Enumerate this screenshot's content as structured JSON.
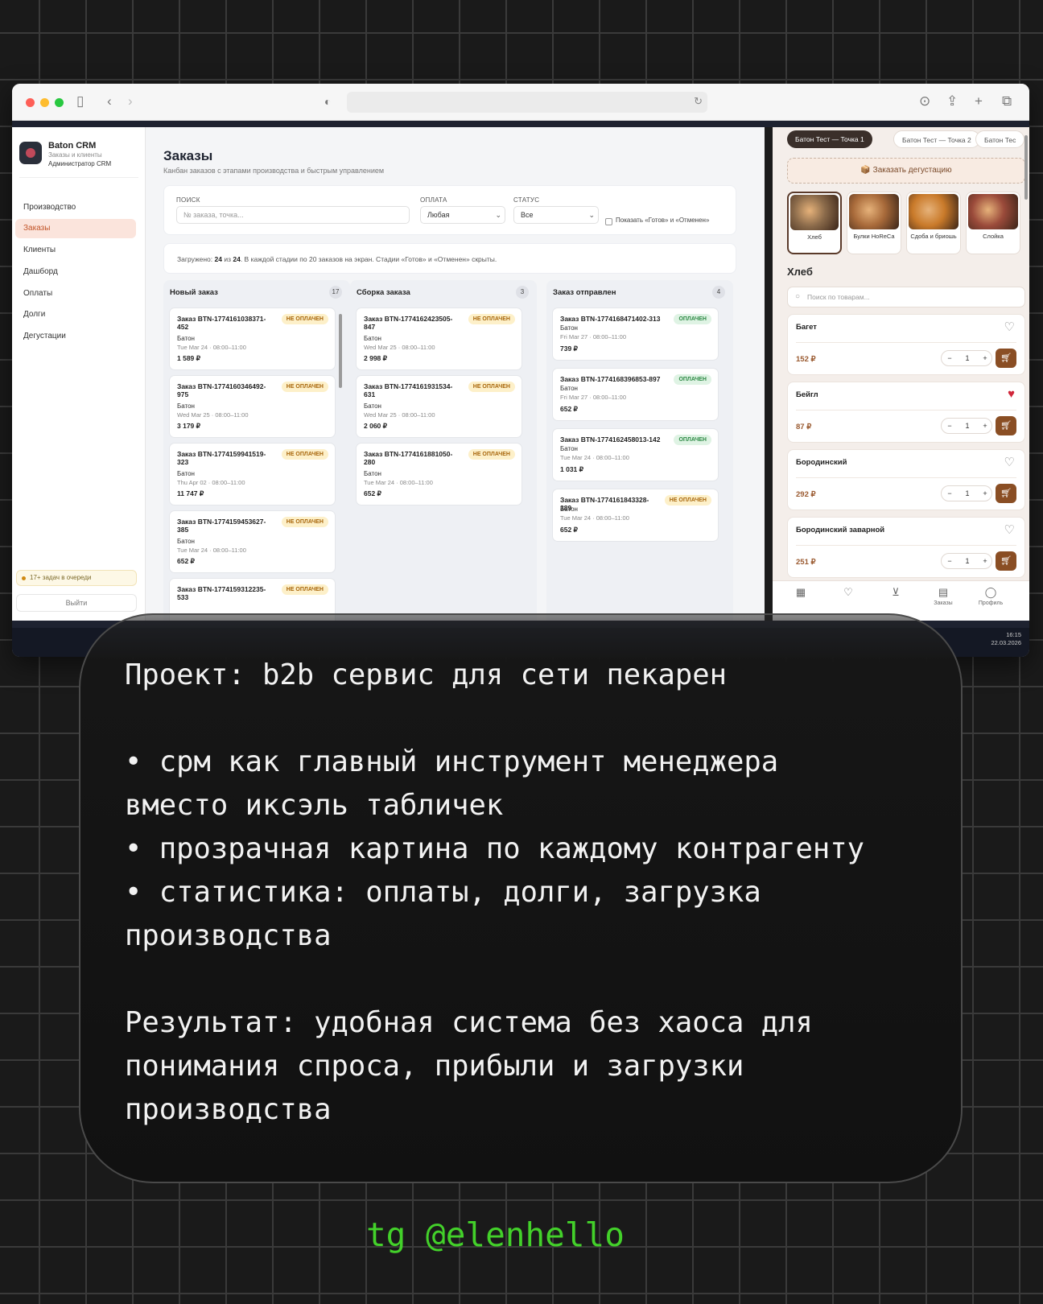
{
  "crm": {
    "brand": {
      "name": "Baton CRM",
      "subtitle": "Заказы и клиенты",
      "role": "Администратор CRM"
    },
    "nav": [
      "Производство",
      "Заказы",
      "Клиенты",
      "Дашборд",
      "Оплаты",
      "Долги",
      "Дегустации"
    ],
    "active_nav": "Заказы",
    "queue_note": "17+ задач в очереди",
    "logout": "Выйти",
    "page": {
      "title": "Заказы",
      "subtitle": "Канбан заказов с этапами производства и быстрым управлением"
    },
    "filters": {
      "search_label": "ПОИСК",
      "search_placeholder": "№ заказа, точка...",
      "payment_label": "ОПЛАТА",
      "payment_value": "Любая",
      "status_label": "СТАТУС",
      "status_value": "Все",
      "show_done_label": "Показать «Готов» и «Отменен»"
    },
    "loaded": {
      "prefix": "Загружено: ",
      "loaded": "24",
      "of": " из ",
      "total": "24",
      "suffix": ". В каждой стадии по 20 заказов на экран. Стадии «Готов» и «Отменен» скрыты."
    },
    "columns": [
      {
        "title": "Новый заказ",
        "count": "17",
        "cards": [
          {
            "id": "Заказ BTN-1774161038371-452",
            "badge": "НЕ ОПЛАЧЕН",
            "paid": false,
            "product": "Батон",
            "date": "Tue Mar 24 · 08:00–11:00",
            "sum": "1 589 ₽"
          },
          {
            "id": "Заказ BTN-1774160346492-975",
            "badge": "НЕ ОПЛАЧЕН",
            "paid": false,
            "product": "Батон",
            "date": "Wed Mar 25 · 08:00–11:00",
            "sum": "3 179 ₽"
          },
          {
            "id": "Заказ BTN-1774159941519-323",
            "badge": "НЕ ОПЛАЧЕН",
            "paid": false,
            "product": "Батон",
            "date": "Thu Apr 02 · 08:00–11:00",
            "sum": "11 747 ₽"
          },
          {
            "id": "Заказ BTN-1774159453627-385",
            "badge": "НЕ ОПЛАЧЕН",
            "paid": false,
            "product": "Батон",
            "date": "Tue Mar 24 · 08:00–11:00",
            "sum": "652 ₽"
          },
          {
            "id": "Заказ BTN-1774159312235-533",
            "badge": "НЕ ОПЛАЧЕН",
            "paid": false,
            "product": "",
            "date": "",
            "sum": ""
          }
        ]
      },
      {
        "title": "Сборка заказа",
        "count": "3",
        "cards": [
          {
            "id": "Заказ BTN-1774162423505-847",
            "badge": "НЕ ОПЛАЧЕН",
            "paid": false,
            "product": "Батон",
            "date": "Wed Mar 25 · 08:00–11:00",
            "sum": "2 998 ₽"
          },
          {
            "id": "Заказ BTN-1774161931534-631",
            "badge": "НЕ ОПЛАЧЕН",
            "paid": false,
            "product": "Батон",
            "date": "Wed Mar 25 · 08:00–11:00",
            "sum": "2 060 ₽"
          },
          {
            "id": "Заказ BTN-1774161881050-280",
            "badge": "НЕ ОПЛАЧЕН",
            "paid": false,
            "product": "Батон",
            "date": "Tue Mar 24 · 08:00–11:00",
            "sum": "652 ₽"
          }
        ]
      },
      {
        "title": "Заказ отправлен",
        "count": "4",
        "cards": [
          {
            "id": "Заказ BTN-1774168471402-313",
            "badge": "ОПЛАЧЕН",
            "paid": true,
            "product": "Батон",
            "date": "Fri Mar 27 · 08:00–11:00",
            "sum": "739 ₽"
          },
          {
            "id": "Заказ BTN-1774168396853-897",
            "badge": "ОПЛАЧЕН",
            "paid": true,
            "product": "Батон",
            "date": "Fri Mar 27 · 08:00–11:00",
            "sum": "652 ₽"
          },
          {
            "id": "Заказ BTN-1774162458013-142",
            "badge": "ОПЛАЧЕН",
            "paid": true,
            "product": "Батон",
            "date": "Tue Mar 24 · 08:00–11:00",
            "sum": "1 031 ₽"
          },
          {
            "id": "Заказ BTN-1774161843328-389",
            "badge": "НЕ ОПЛАЧЕН",
            "paid": false,
            "product": "Батон",
            "date": "Tue Mar 24 · 08:00–11:00",
            "sum": "652 ₽"
          }
        ]
      }
    ]
  },
  "shop": {
    "tabs": [
      "Батон Тест — Точка 1",
      "Батон Тест — Точка 2",
      "Батон Тес"
    ],
    "tasting_button": "📦 Заказать дегустацию",
    "categories": [
      {
        "label": "Хлеб",
        "color": "#8a6a4a"
      },
      {
        "label": "Булки HoReCa",
        "color": "#a86a3a"
      },
      {
        "label": "Сдоба и бриошь",
        "color": "#c97a2a"
      },
      {
        "label": "Слойка",
        "color": "#9a4a3a"
      }
    ],
    "section_title": "Хлеб",
    "search_placeholder": "Поиск по товарам...",
    "products": [
      {
        "name": "Багет",
        "price": "152 ₽",
        "qty": "1",
        "favorite": false
      },
      {
        "name": "Бейгл",
        "price": "87 ₽",
        "qty": "1",
        "favorite": true
      },
      {
        "name": "Бородинский",
        "price": "292 ₽",
        "qty": "1",
        "favorite": false
      },
      {
        "name": "Бородинский заварной",
        "price": "251 ₽",
        "qty": "1",
        "favorite": false
      }
    ],
    "bottom_nav": [
      {
        "icon": "catalog-icon",
        "label": ""
      },
      {
        "icon": "heart-icon",
        "label": ""
      },
      {
        "icon": "cart-icon",
        "label": ""
      },
      {
        "icon": "orders-icon",
        "label": "Заказы"
      },
      {
        "icon": "profile-icon",
        "label": "Профиль"
      }
    ]
  },
  "taskbar": {
    "time": "16:15",
    "date": "22.03.2026"
  },
  "card_text": "Проект: b2b сервис для сети пекарен\n\n• срм как главный инструмент менеджера\nвместо иксэль табличек\n• прозрачная картина по каждому контрагенту\n• статистика: оплаты, долги, загрузка\nпроизводства\n\nРезультат: удобная система без хаоса для\nпонимания спроса, прибыли и загрузки\nпроизводства",
  "contact": "tg @elenhello",
  "colors": {
    "accent_green": "#43d12a",
    "unpaid_badge": "#fdf0c9",
    "paid_badge": "#dff3e4",
    "cart_button": "#8a4e24"
  }
}
